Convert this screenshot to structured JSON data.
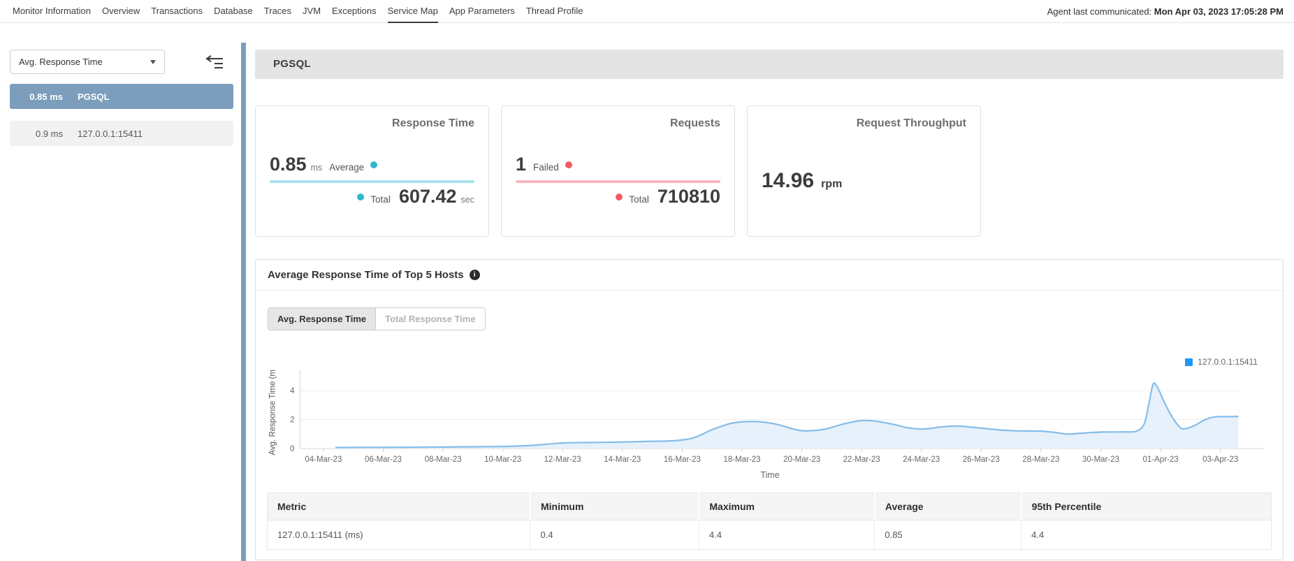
{
  "nav": {
    "items": [
      {
        "label": "Monitor Information",
        "active": false
      },
      {
        "label": "Overview",
        "active": false
      },
      {
        "label": "Transactions",
        "active": false
      },
      {
        "label": "Database",
        "active": false
      },
      {
        "label": "Traces",
        "active": false
      },
      {
        "label": "JVM",
        "active": false
      },
      {
        "label": "Exceptions",
        "active": false
      },
      {
        "label": "Service Map",
        "active": true
      },
      {
        "label": "App Parameters",
        "active": false
      },
      {
        "label": "Thread Profile",
        "active": false
      }
    ],
    "agent_label": "Agent last communicated:",
    "agent_value": "Mon Apr 03, 2023 17:05:28 PM"
  },
  "sidebar": {
    "metric_dropdown": {
      "value": "Avg. Response Time"
    },
    "items": [
      {
        "value": "0.85 ms",
        "name": "PGSQL",
        "selected": true
      },
      {
        "value": "0.9 ms",
        "name": "127.0.0.1:15411",
        "selected": false
      }
    ],
    "selected_color": "#7c9dbc"
  },
  "header": {
    "title": "PGSQL"
  },
  "cards": {
    "response_time": {
      "title": "Response Time",
      "avg_value": "0.85",
      "avg_unit": "ms",
      "avg_label": "Average",
      "total_label": "Total",
      "total_value": "607.42",
      "total_unit": "sec",
      "accent": "#2fb8cb",
      "accent_light": "#a9e3ec"
    },
    "requests": {
      "title": "Requests",
      "failed_value": "1",
      "failed_label": "Failed",
      "total_label": "Total",
      "total_value": "710810",
      "accent": "#f25b66",
      "accent_light": "#f8b7c0"
    },
    "throughput": {
      "title": "Request Throughput",
      "value": "14.96",
      "unit": "rpm"
    }
  },
  "chart_panel": {
    "title": "Average Response Time of Top 5 Hosts",
    "info_glyph": "i",
    "tabs": [
      {
        "label": "Avg. Response Time",
        "active": true
      },
      {
        "label": "Total Response Time",
        "active": false
      }
    ]
  },
  "chart_data": {
    "type": "area",
    "title": "Average Response Time of Top 5 Hosts",
    "xlabel": "Time",
    "ylabel": "Avg. Response Time (ms)",
    "x_tick_labels": [
      "04-Mar-23",
      "06-Mar-23",
      "08-Mar-23",
      "10-Mar-23",
      "12-Mar-23",
      "14-Mar-23",
      "16-Mar-23",
      "18-Mar-23",
      "20-Mar-23",
      "22-Mar-23",
      "24-Mar-23",
      "26-Mar-23",
      "28-Mar-23",
      "30-Mar-23",
      "01-Apr-23",
      "03-Apr-23"
    ],
    "x_tick_interval_days": 2,
    "x_unit": "days since 04-Mar-23",
    "y_ticks": [
      0,
      2,
      4
    ],
    "ylim": [
      0,
      5.45
    ],
    "grid": "horizontal",
    "legend_position": "top-right",
    "series": [
      {
        "name": "127.0.0.1:15411",
        "color": "#2196f3",
        "line_color": "#85bde9",
        "fill_color": "#e7f1fb",
        "points": [
          [
            0.4,
            0.07
          ],
          [
            1,
            0.08
          ],
          [
            2,
            0.08
          ],
          [
            3,
            0.09
          ],
          [
            4,
            0.1
          ],
          [
            5,
            0.12
          ],
          [
            6,
            0.14
          ],
          [
            6.5,
            0.17
          ],
          [
            7,
            0.22
          ],
          [
            7.5,
            0.3
          ],
          [
            8,
            0.38
          ],
          [
            9,
            0.42
          ],
          [
            10,
            0.45
          ],
          [
            11,
            0.5
          ],
          [
            11.8,
            0.55
          ],
          [
            12.4,
            0.75
          ],
          [
            13,
            1.3
          ],
          [
            13.6,
            1.72
          ],
          [
            14.1,
            1.85
          ],
          [
            14.7,
            1.83
          ],
          [
            15.2,
            1.65
          ],
          [
            15.8,
            1.3
          ],
          [
            16.2,
            1.22
          ],
          [
            16.8,
            1.35
          ],
          [
            17.4,
            1.7
          ],
          [
            18,
            1.93
          ],
          [
            18.5,
            1.88
          ],
          [
            19.1,
            1.65
          ],
          [
            19.6,
            1.42
          ],
          [
            20.1,
            1.35
          ],
          [
            20.7,
            1.5
          ],
          [
            21.2,
            1.55
          ],
          [
            21.8,
            1.45
          ],
          [
            22.5,
            1.3
          ],
          [
            23.2,
            1.22
          ],
          [
            24,
            1.2
          ],
          [
            24.5,
            1.1
          ],
          [
            24.9,
            1.0
          ],
          [
            25.5,
            1.08
          ],
          [
            26.1,
            1.14
          ],
          [
            26.8,
            1.15
          ],
          [
            27.2,
            1.2
          ],
          [
            27.45,
            1.7
          ],
          [
            27.6,
            3.0
          ],
          [
            27.75,
            4.45
          ],
          [
            27.9,
            4.2
          ],
          [
            28.1,
            3.3
          ],
          [
            28.35,
            2.3
          ],
          [
            28.65,
            1.45
          ],
          [
            28.85,
            1.38
          ],
          [
            29.15,
            1.6
          ],
          [
            29.5,
            2.0
          ],
          [
            29.8,
            2.18
          ],
          [
            30.2,
            2.2
          ],
          [
            30.6,
            2.22
          ]
        ]
      }
    ]
  },
  "table": {
    "columns": [
      "Metric",
      "Minimum",
      "Maximum",
      "Average",
      "95th Percentile"
    ],
    "rows": [
      [
        "127.0.0.1:15411 (ms)",
        "0.4",
        "4.4",
        "0.85",
        "4.4"
      ]
    ]
  }
}
